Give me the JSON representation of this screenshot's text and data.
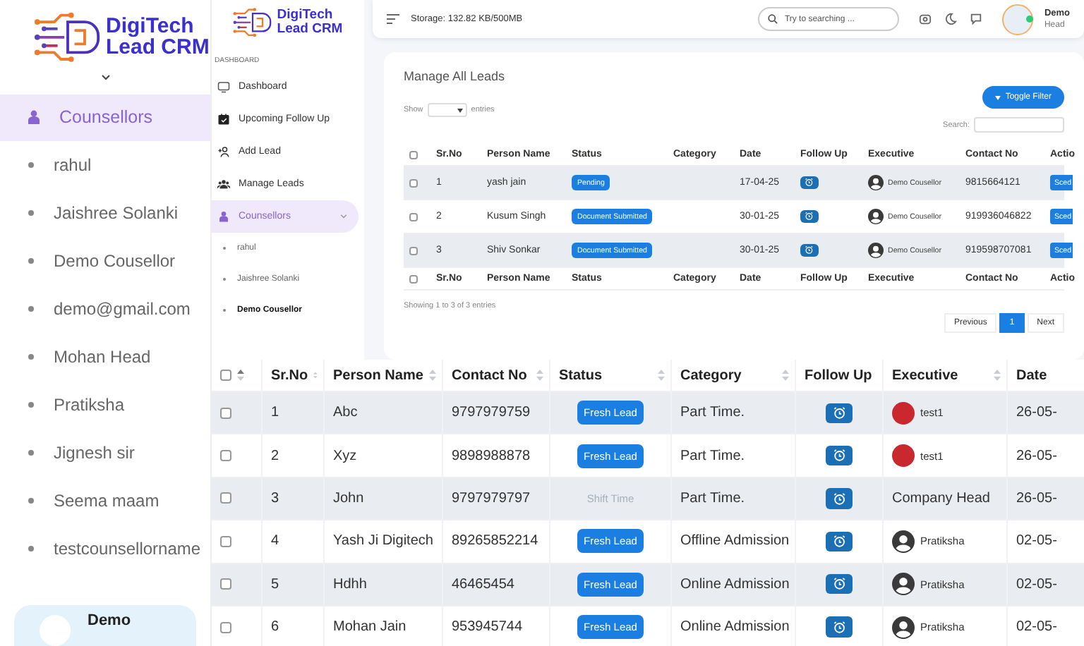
{
  "sidebar": {
    "logo": {
      "line1": "DigiTech",
      "line2": "Lead CRM"
    },
    "section": {
      "label": "Counsellors",
      "selected": true
    },
    "items": [
      {
        "label": "rahul"
      },
      {
        "label": "Jaishree Solanki"
      },
      {
        "label": "Demo Cousellor"
      },
      {
        "label": "demo@gmail.com"
      },
      {
        "label": "Mohan Head"
      },
      {
        "label": "Pratiksha"
      },
      {
        "label": "Jignesh sir"
      },
      {
        "label": "Seema maam"
      },
      {
        "label": "testcounsellorname"
      }
    ],
    "profile": {
      "name": "Demo"
    }
  },
  "app": {
    "sidebar": {
      "logo": {
        "line1": "DigiTech",
        "line2": "Lead CRM"
      },
      "heading": "DASHBOARD",
      "items": [
        {
          "label": "Dashboard",
          "selected": false
        },
        {
          "label": "Upcoming Follow Up",
          "selected": false
        },
        {
          "label": "Add Lead",
          "selected": false
        },
        {
          "label": "Manage Leads",
          "selected": false
        },
        {
          "label": "Counsellors",
          "selected": true
        }
      ],
      "subitems": [
        {
          "label": "rahul",
          "selected": false
        },
        {
          "label": "Jaishree Solanki",
          "selected": false
        },
        {
          "label": "Demo Cousellor",
          "selected": true
        }
      ]
    },
    "topbar": {
      "storage": "Storage: 132.82 KB/500MB",
      "search": {
        "placeholder": "Try to searching ..."
      },
      "user": {
        "name": "Demo",
        "role": "Head"
      }
    },
    "card": {
      "title": "Manage All Leads",
      "toggle_button": "Toggle Filter",
      "show_label": "Show",
      "entries_label": "entries",
      "search_label": "Search:",
      "table": {
        "header_checked": false,
        "footer_checked": false,
        "columns": [
          "Sr.No",
          "Person Name",
          "Status",
          "Category",
          "Date",
          "Follow Up",
          "Executive",
          "Contact No",
          "Actio"
        ],
        "rows": [
          {
            "checked": false,
            "sr": "1",
            "name": "yash jain",
            "status": "Pending",
            "date": "17-04-25",
            "executive": "Demo Cousellor",
            "contact": "9815664121",
            "action": "Sced"
          },
          {
            "checked": false,
            "sr": "2",
            "name": "Kusum Singh",
            "status": "Document Submitted",
            "date": "30-01-25",
            "executive": "Demo Cousellor",
            "contact": "919936046822",
            "action": "Sced"
          },
          {
            "checked": false,
            "sr": "3",
            "name": "Shiv Sonkar",
            "status": "Document Submitted",
            "date": "30-01-25",
            "executive": "Demo Cousellor",
            "contact": "919598707081",
            "action": "Sced"
          }
        ],
        "footer_columns": [
          "Sr.No",
          "Person Name",
          "Status",
          "Category",
          "Date",
          "Follow Up",
          "Executive",
          "Contact No",
          "Actio"
        ]
      },
      "info": "Showing 1 to 3 of 3 entries",
      "pagination": [
        {
          "label": "Previous",
          "selected": false
        },
        {
          "label": "1",
          "selected": true
        },
        {
          "label": "Next",
          "selected": false
        }
      ]
    }
  },
  "table": {
    "header_checked": false,
    "columns": [
      "Sr.No",
      "Person Name",
      "Contact No",
      "Status",
      "Category",
      "Follow Up",
      "Executive",
      "Date"
    ],
    "rows": [
      {
        "checked": false,
        "sr": "1",
        "name": "Abc",
        "contact": "9797979759",
        "status": {
          "label": "Fresh Lead",
          "kind": "badge"
        },
        "category": "Part Time.",
        "executive": {
          "name": "test1",
          "kind": "photo"
        },
        "date": "26-05-"
      },
      {
        "checked": false,
        "sr": "2",
        "name": "Xyz",
        "contact": "9898988878",
        "status": {
          "label": "Fresh Lead",
          "kind": "badge"
        },
        "category": "Part Time.",
        "executive": {
          "name": "test1",
          "kind": "photo"
        },
        "date": "26-05-"
      },
      {
        "checked": false,
        "sr": "3",
        "name": "John",
        "contact": "9797979797",
        "status": {
          "label": "Shift Time",
          "kind": "faint"
        },
        "category": "Part Time.",
        "executive": {
          "name": "Company Head",
          "kind": "plain"
        },
        "date": "26-05-"
      },
      {
        "checked": false,
        "sr": "4",
        "name": "Yash Ji Digitech",
        "contact": "89265852214",
        "status": {
          "label": "Fresh Lead",
          "kind": "badge"
        },
        "category": "Offline Admission",
        "executive": {
          "name": "Pratiksha",
          "kind": "silhouette"
        },
        "date": "02-05-"
      },
      {
        "checked": false,
        "sr": "5",
        "name": "Hdhh",
        "contact": "46465454",
        "status": {
          "label": "Fresh Lead",
          "kind": "badge"
        },
        "category": "Online Admission",
        "executive": {
          "name": "Pratiksha",
          "kind": "silhouette"
        },
        "date": "02-05-"
      },
      {
        "checked": false,
        "sr": "6",
        "name": "Mohan Jain",
        "contact": "953945744",
        "status": {
          "label": "Fresh Lead",
          "kind": "badge"
        },
        "category": "Online Admission",
        "executive": {
          "name": "Pratiksha",
          "kind": "silhouette"
        },
        "date": "02-05-"
      }
    ]
  }
}
